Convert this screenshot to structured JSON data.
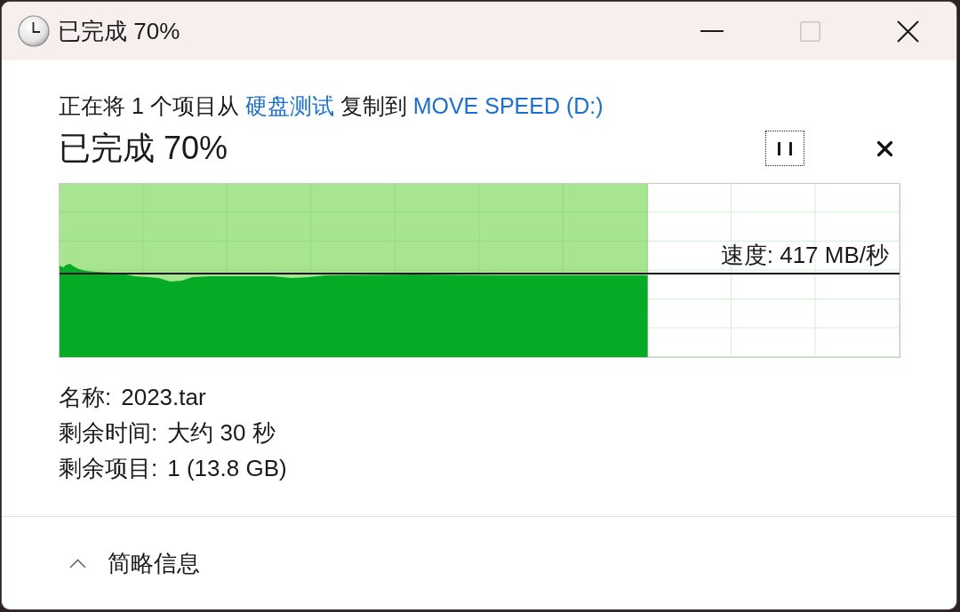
{
  "window": {
    "title": "已完成 70%",
    "controls": [
      {
        "kind": "minimize",
        "disabled": false
      },
      {
        "kind": "maximize",
        "disabled": true
      },
      {
        "kind": "close",
        "disabled": false
      }
    ]
  },
  "description": [
    {
      "kind": "text",
      "text": "正在将 1 个项目从"
    },
    {
      "kind": "link",
      "text": "硬盘测试"
    },
    {
      "kind": "text",
      "text": "复制到"
    },
    {
      "kind": "link",
      "text": "MOVE SPEED (D:)"
    }
  ],
  "status": {
    "title": "已完成 70%",
    "pause_button": {
      "focused": true
    }
  },
  "progress": {
    "level": 0.7,
    "speed": "速度: 417 MB/秒"
  },
  "details": [
    {
      "label": "名称:",
      "value": "2023.tar"
    },
    {
      "label": "剩余时间:",
      "value": "大约 30 秒"
    },
    {
      "label": "剩余项目:",
      "value": "1 (13.8 GB)"
    }
  ],
  "footer": {
    "label": "简略信息",
    "expanded": true
  }
}
